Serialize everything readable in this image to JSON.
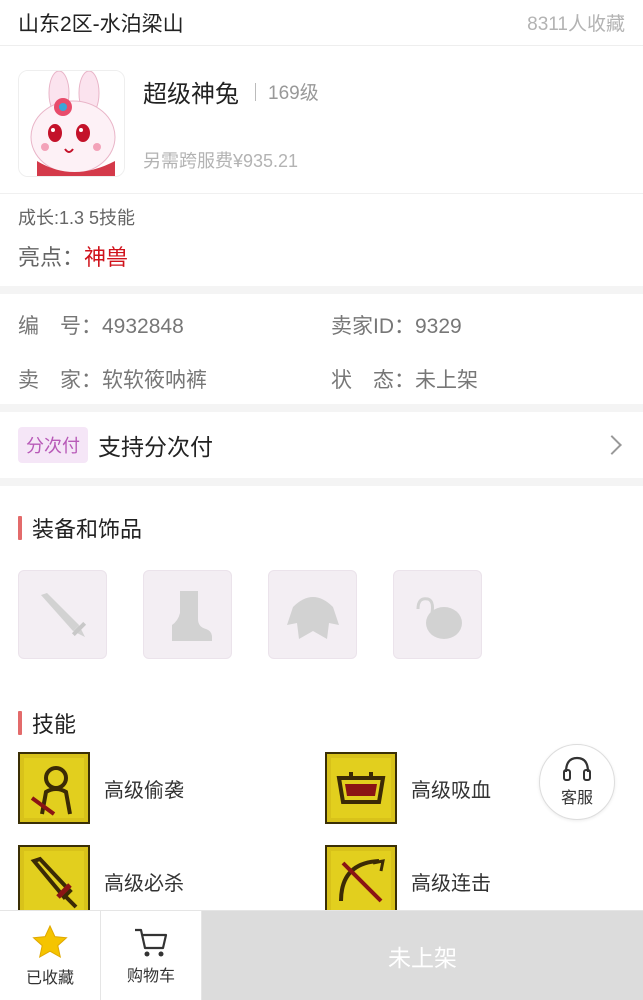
{
  "header": {
    "server": "山东2区-水泊梁山",
    "favorites": "8311人收藏"
  },
  "pet": {
    "name": "超级神兔",
    "level": "169级",
    "fee": "另需跨服费¥935.21",
    "growth": "成长:1.3 5技能",
    "highlight_label": "亮点：",
    "highlight_value": "神兽"
  },
  "info": {
    "id_label": "编　号：",
    "id_value": "4932848",
    "seller_id_label": "卖家ID：",
    "seller_id_value": "9329",
    "seller_label": "卖　家：",
    "seller_value": "软软筱呐裤",
    "status_label": "状　态：",
    "status_value": "未上架"
  },
  "installment": {
    "tag": "分次付",
    "text": "支持分次付"
  },
  "equipment": {
    "title": "装备和饰品",
    "slots": [
      {
        "icon": "sword-icon"
      },
      {
        "icon": "boot-icon"
      },
      {
        "icon": "armor-icon"
      },
      {
        "icon": "accessory-icon"
      }
    ]
  },
  "skills": {
    "title": "技能",
    "items": [
      {
        "name": "高级偷袭",
        "icon": "sneak-attack-icon"
      },
      {
        "name": "高级吸血",
        "icon": "vampire-icon"
      },
      {
        "name": "高级必杀",
        "icon": "critical-icon"
      },
      {
        "name": "高级连击",
        "icon": "combo-icon"
      }
    ]
  },
  "service": {
    "label": "客服"
  },
  "bottombar": {
    "favorite_label": "已收藏",
    "cart_label": "购物车",
    "main_label": "未上架"
  },
  "colors": {
    "accent_red": "#d0121b",
    "skill_gold": "#d8c21a",
    "installment_purple": "#b85ab8",
    "disabled_gray": "#dcdcdc"
  }
}
